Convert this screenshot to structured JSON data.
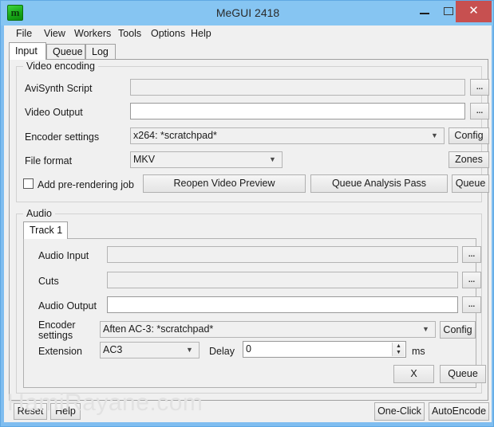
{
  "window": {
    "title": "MeGUI 2418",
    "icon": "megui-app-icon",
    "controls": {
      "minimize": "minimize-icon",
      "maximize": "maximize-icon",
      "close": "✕"
    }
  },
  "menubar": {
    "items": [
      {
        "label": "File"
      },
      {
        "label": "View"
      },
      {
        "label": "Workers"
      },
      {
        "label": "Tools"
      },
      {
        "label": "Options"
      },
      {
        "label": "Help"
      }
    ]
  },
  "tabs": [
    {
      "label": "Input",
      "active": true
    },
    {
      "label": "Queue",
      "active": false
    },
    {
      "label": "Log",
      "active": false
    }
  ],
  "video_encoding": {
    "group_title": "Video encoding",
    "avisynth_script": {
      "label": "AviSynth Script",
      "value": "",
      "browse_label": "..."
    },
    "video_output": {
      "label": "Video Output",
      "value": "",
      "browse_label": "..."
    },
    "encoder_settings": {
      "label": "Encoder settings",
      "value": "x264: *scratchpad*",
      "config_label": "Config"
    },
    "file_format": {
      "label": "File format",
      "value": "MKV",
      "zones_label": "Zones"
    },
    "pre_rendering": {
      "label": "Add pre-rendering job",
      "checked": false
    },
    "buttons": {
      "reopen_preview": "Reopen Video Preview",
      "queue_analysis": "Queue Analysis Pass",
      "queue": "Queue"
    }
  },
  "audio": {
    "group_title": "Audio",
    "track_tab": "Track 1",
    "audio_input": {
      "label": "Audio Input",
      "value": "",
      "browse_label": "..."
    },
    "cuts": {
      "label": "Cuts",
      "value": "",
      "browse_label": "..."
    },
    "audio_output": {
      "label": "Audio Output",
      "value": "",
      "browse_label": "..."
    },
    "encoder_settings": {
      "label_line1": "Encoder",
      "label_line2": "settings",
      "value": "Aften AC-3: *scratchpad*",
      "config_label": "Config"
    },
    "extension": {
      "label": "Extension",
      "value": "AC3"
    },
    "delay": {
      "label": "Delay",
      "value": "0",
      "unit": "ms"
    },
    "buttons": {
      "remove": "X",
      "queue": "Queue"
    }
  },
  "bottom": {
    "reset": "Reset",
    "help": "Help",
    "one_click": "One-Click",
    "auto_encode": "AutoEncode"
  },
  "watermark": "HamiRayane.com"
}
